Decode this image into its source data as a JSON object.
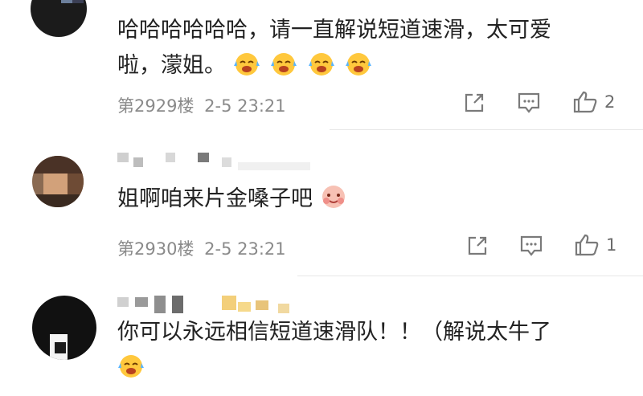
{
  "comments": [
    {
      "text_line1": "哈哈哈哈哈哈，请一直解说短道速滑，太可爱",
      "text_line2": "啦，濛姐。",
      "floor": "第2929楼",
      "time": "2-5 23:21",
      "likes": "2",
      "emoji": "laugh-cry-emoji"
    },
    {
      "text": "姐啊咱来片金嗓子吧",
      "floor": "第2930楼",
      "time": "2-5 23:21",
      "likes": "1",
      "emoji": "hug-emoji"
    },
    {
      "text_line1": "你可以永远相信短道速滑队！！（解说太牛了",
      "emoji": "laugh-cry-emoji"
    }
  ],
  "colors": {
    "text": "#222222",
    "meta": "#8a8a8a",
    "icon": "#7a7a7a",
    "emoji_face": "#FFC83D"
  },
  "icons": [
    "share-icon",
    "comment-icon",
    "thumbs-up-icon"
  ]
}
